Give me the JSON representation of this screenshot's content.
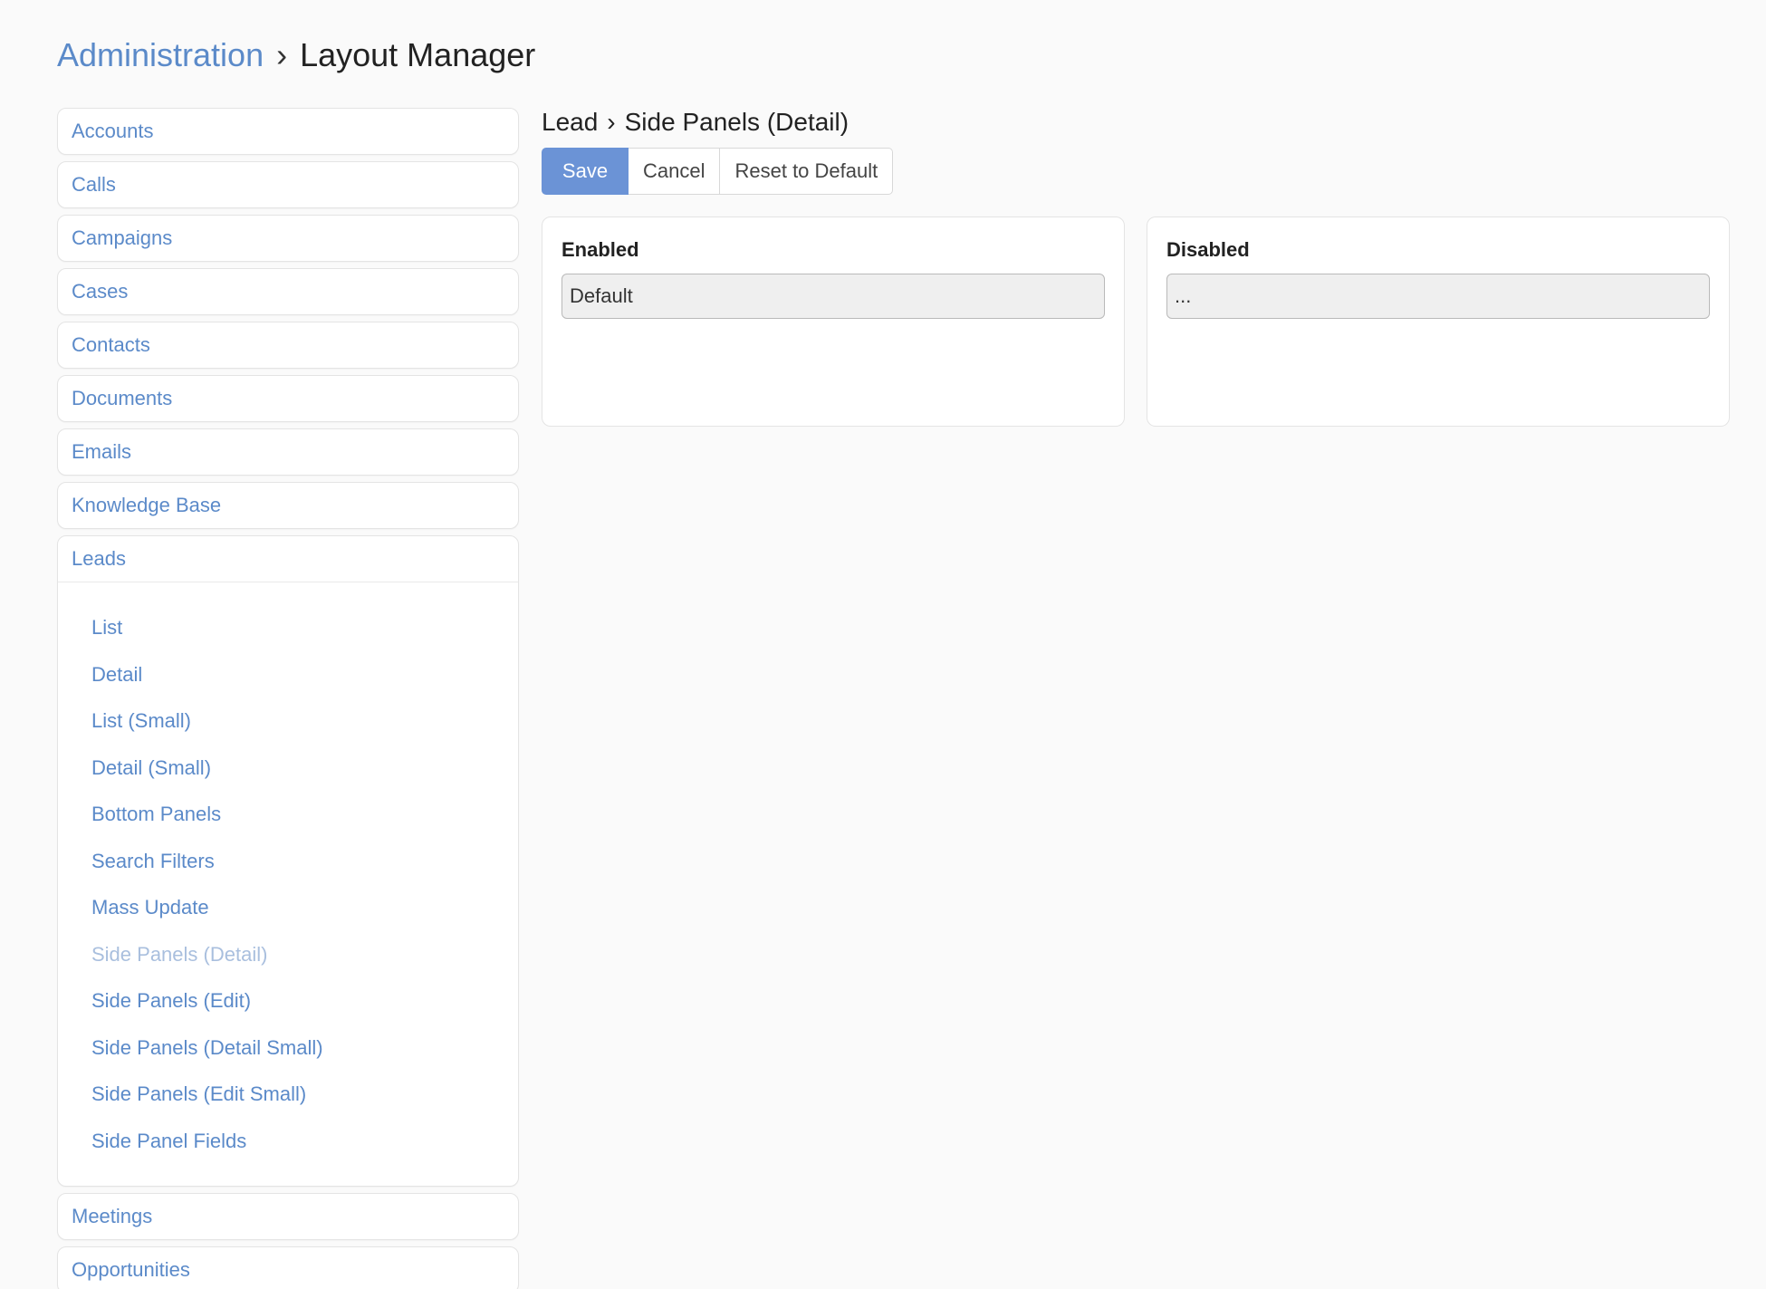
{
  "breadcrumb": {
    "root": "Administration",
    "separator": "›",
    "current": "Layout Manager"
  },
  "sidebar": {
    "items_before": [
      {
        "label": "Accounts"
      },
      {
        "label": "Calls"
      },
      {
        "label": "Campaigns"
      },
      {
        "label": "Cases"
      },
      {
        "label": "Contacts"
      },
      {
        "label": "Documents"
      },
      {
        "label": "Emails"
      },
      {
        "label": "Knowledge Base"
      }
    ],
    "open_item": {
      "label": "Leads",
      "sub_items": [
        {
          "label": "List"
        },
        {
          "label": "Detail"
        },
        {
          "label": "List (Small)"
        },
        {
          "label": "Detail (Small)"
        },
        {
          "label": "Bottom Panels"
        },
        {
          "label": "Search Filters"
        },
        {
          "label": "Mass Update"
        },
        {
          "label": "Side Panels (Detail)",
          "active": true
        },
        {
          "label": "Side Panels (Edit)"
        },
        {
          "label": "Side Panels (Detail Small)"
        },
        {
          "label": "Side Panels (Edit Small)"
        },
        {
          "label": "Side Panel Fields"
        }
      ]
    },
    "items_after": [
      {
        "label": "Meetings"
      },
      {
        "label": "Opportunities"
      }
    ]
  },
  "content": {
    "entity": "Lead",
    "separator": "›",
    "layout": "Side Panels (Detail)",
    "buttons": {
      "save": "Save",
      "cancel": "Cancel",
      "reset": "Reset to Default"
    },
    "enabled": {
      "title": "Enabled",
      "items": [
        "Default"
      ]
    },
    "disabled": {
      "title": "Disabled",
      "items": [
        "..."
      ]
    }
  },
  "colors": {
    "link": "#5b8ac9",
    "active_link": "#a9bfde",
    "primary_button": "#6b93d6"
  }
}
